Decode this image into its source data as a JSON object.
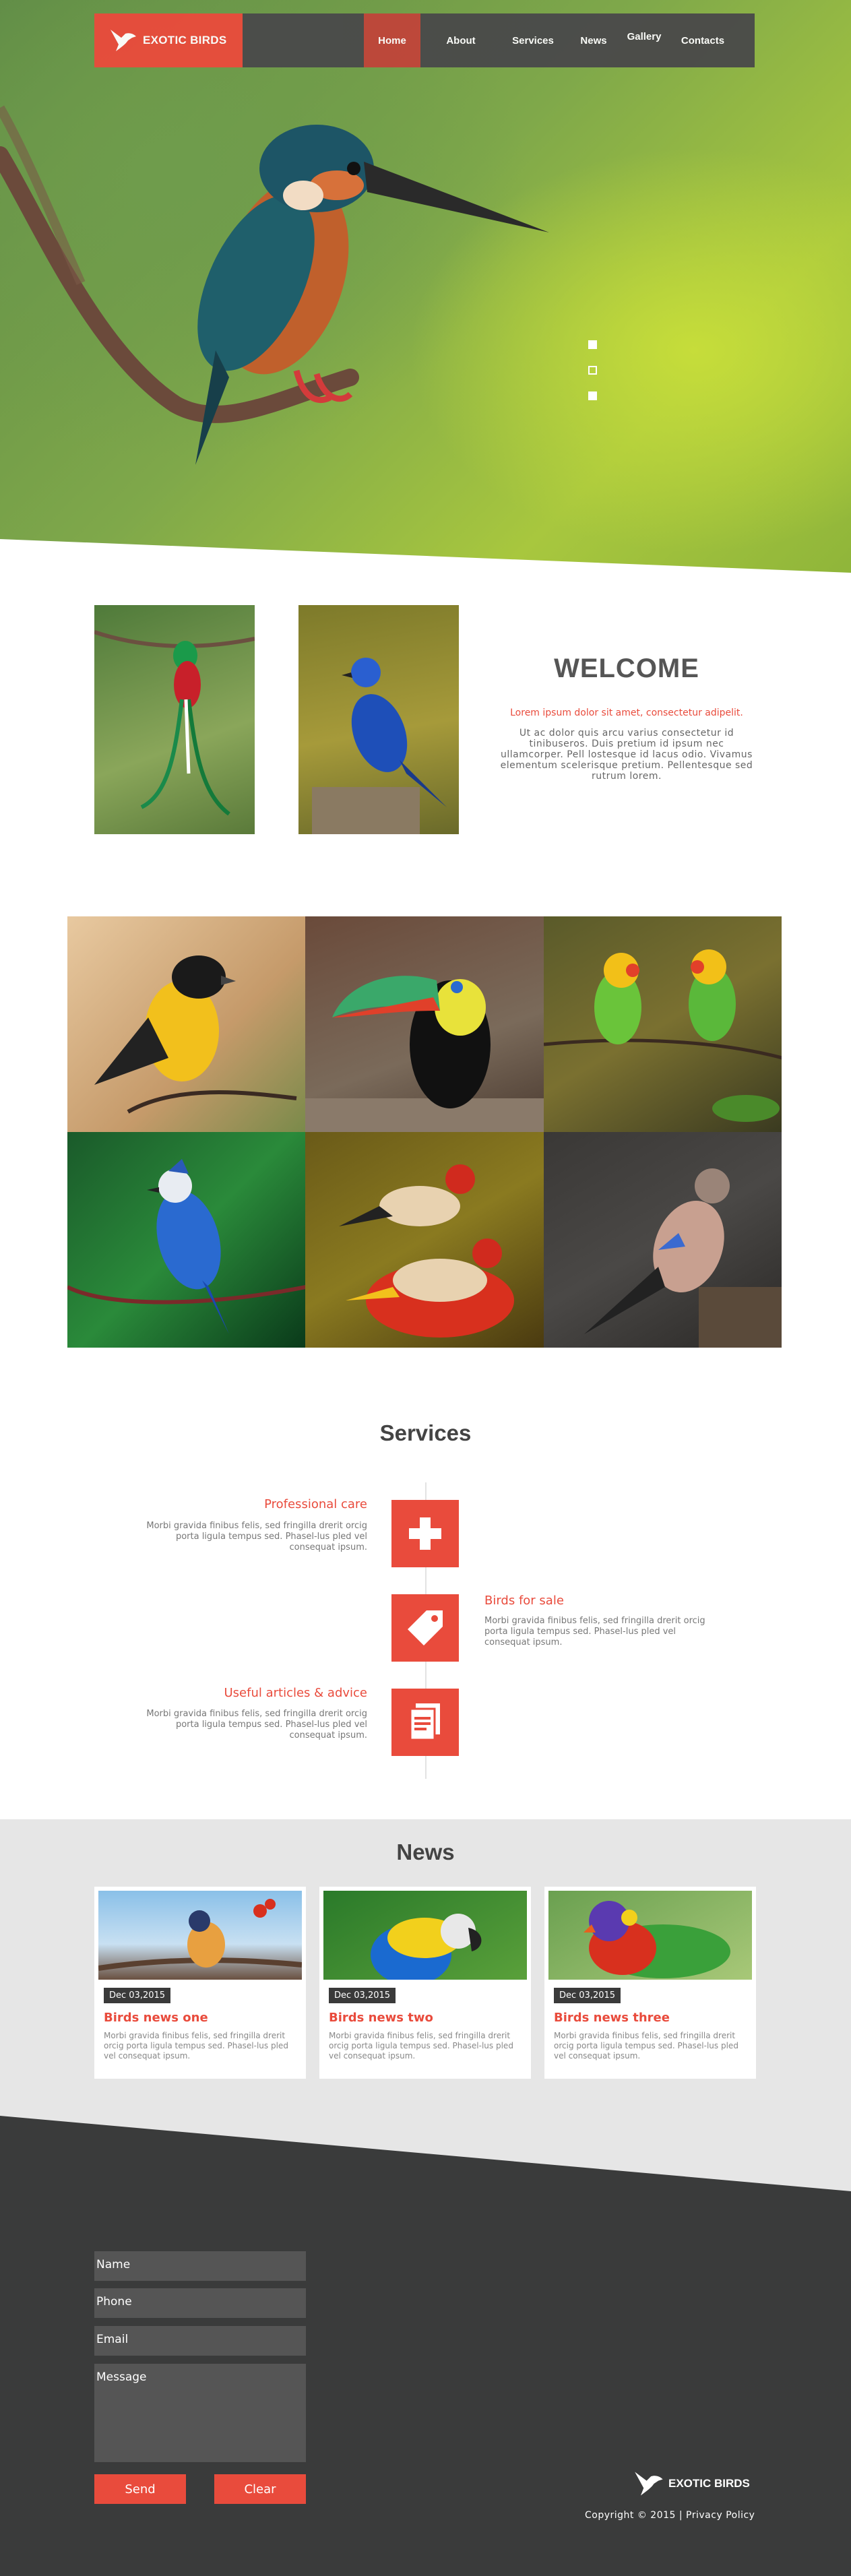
{
  "brand": {
    "name": "EXOTIC BIRDS",
    "accent": "#e94b3c",
    "dark": "#3a3b3b"
  },
  "nav": {
    "items": [
      {
        "label": "Home"
      },
      {
        "label": "About"
      },
      {
        "label": "Services"
      },
      {
        "label": "News"
      },
      {
        "label": "Gallery"
      },
      {
        "label": "Contacts"
      }
    ],
    "active": "Home"
  },
  "hero": {
    "slide_count": 3,
    "active_slide": 1
  },
  "welcome": {
    "title": "WELCOME",
    "lead": "Lorem ipsum dolor sit amet, consectetur adipelit.",
    "body": "Ut ac dolor quis arcu varius consectetur id tinibuseros. Duis pretium id ipsum nec ullamcorper. Pell lostesque id lacus odio. Vivamus elementum scelerisque pretium. Pellentesque sed rutrum lorem."
  },
  "services": {
    "title": "Services",
    "items": [
      {
        "title": "Professional care",
        "text": "Morbi gravida finibus felis, sed fringilla drerit orcig porta ligula tempus sed. Phasel-lus pled vel consequat ipsum.",
        "icon": "plus-icon"
      },
      {
        "title": "Birds for sale",
        "text": "Morbi gravida finibus felis, sed fringilla drerit orcig porta ligula tempus sed. Phasel-lus pled vel consequat ipsum.",
        "icon": "tag-icon"
      },
      {
        "title": "Useful articles & advice",
        "text": "Morbi gravida finibus felis, sed fringilla drerit orcig porta ligula tempus sed. Phasel-lus pled vel consequat ipsum.",
        "icon": "document-icon"
      }
    ]
  },
  "news": {
    "title": "News",
    "items": [
      {
        "date": "Dec 03,2015",
        "title": "Birds news one",
        "text": "Morbi gravida finibus felis, sed fringilla drerit orcig porta ligula tempus sed. Phasel-lus pled vel consequat ipsum."
      },
      {
        "date": "Dec 03,2015",
        "title": "Birds news two",
        "text": "Morbi gravida finibus felis, sed fringilla drerit orcig porta ligula tempus sed. Phasel-lus pled vel consequat ipsum."
      },
      {
        "date": "Dec 03,2015",
        "title": "Birds news three",
        "text": "Morbi gravida finibus felis, sed fringilla drerit orcig porta ligula tempus sed. Phasel-lus pled vel consequat ipsum."
      }
    ]
  },
  "contact": {
    "name_placeholder": "Name",
    "phone_placeholder": "Phone",
    "email_placeholder": "Email",
    "message_placeholder": "Message",
    "send_label": "Send",
    "clear_label": "Clear"
  },
  "footer": {
    "brand": "EXOTIC BIRDS",
    "copyright": "Copyright © 2015 | Privacy Policy"
  }
}
